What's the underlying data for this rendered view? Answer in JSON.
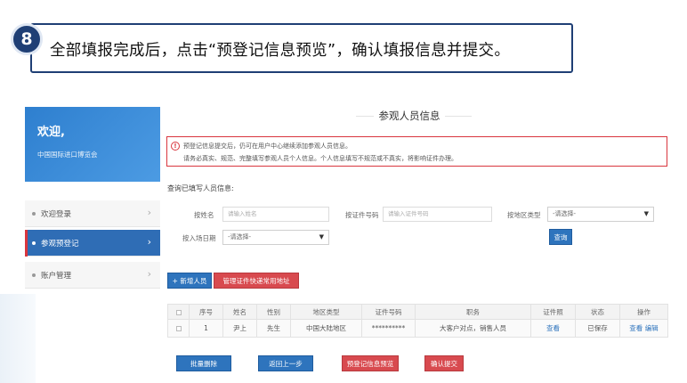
{
  "step": {
    "number": "8",
    "text": "全部填报完成后，点击“预登记信息预览”，确认填报信息并提交。"
  },
  "sidebar": {
    "welcome_title": "欢迎,",
    "welcome_subtitle": "中国国际进口博览会",
    "items": [
      {
        "label": "欢迎登录",
        "chevron": "›"
      },
      {
        "label": "参观预登记",
        "chevron": "›"
      },
      {
        "label": "账户管理",
        "chevron": "›"
      }
    ]
  },
  "main": {
    "title": "参观人员信息",
    "notice": {
      "icon": "!",
      "line1": "预登记信息提交后，仍可在用户中心继续添加参观人员信息。",
      "line2": "请务必真实、规范、完整填写参观人员个人信息。个人信息填写不规范或不真实，将影响证件办理。"
    },
    "query": {
      "section_label": "查询已填写人员信息:",
      "name_label": "按姓名",
      "name_placeholder": "请输入姓名",
      "id_label": "按证件号码",
      "id_placeholder": "请输入证件号码",
      "region_label": "按地区类型",
      "region_value": "-请选择-",
      "date_label": "按入场日期",
      "date_value": "-请选择-",
      "search_button": "查询"
    },
    "actions": {
      "add_button": "+ 新增人员",
      "manage_button": "管理证件快递常用地址"
    },
    "table": {
      "columns": [
        "",
        "序号",
        "姓名",
        "性别",
        "地区类型",
        "证件号码",
        "职务",
        "证件照",
        "状态",
        "操作"
      ],
      "rows": [
        {
          "index": "1",
          "name": "尹上",
          "gender": "先生",
          "region": "中国大陆地区",
          "id_number": "**********",
          "position": "大客户对点，销售人员",
          "photo_link": "查看",
          "status": "已保存",
          "op_view": "查看",
          "op_edit": "编辑"
        }
      ]
    },
    "bottom_buttons": {
      "batch_delete": "批量删除",
      "back": "返回上一步",
      "preview": "预登记信息预览",
      "confirm": "确认提交"
    }
  },
  "colors": {
    "navy": "#1f3f75",
    "primary": "#2e74bd",
    "danger": "#d84a4f"
  }
}
